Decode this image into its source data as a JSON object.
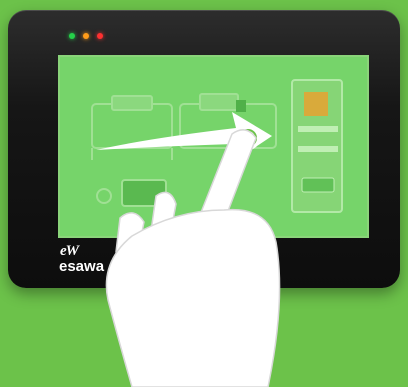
{
  "device": {
    "brand_logo": "eW",
    "brand_text": "esawa",
    "leds": [
      {
        "color": "#25d14a"
      },
      {
        "color": "#ff9c1a"
      },
      {
        "color": "#ff3030"
      }
    ]
  },
  "screen_ui": {
    "buttons": [
      {
        "label": ""
      },
      {
        "label": ""
      }
    ]
  },
  "gesture": {
    "type": "swipe-right",
    "hand_color": "#ffffff",
    "arrow_color": "#ffffff"
  },
  "colors": {
    "background": "#6cc24a",
    "screen_tint": "#76d46a",
    "bezel": "#161616"
  }
}
